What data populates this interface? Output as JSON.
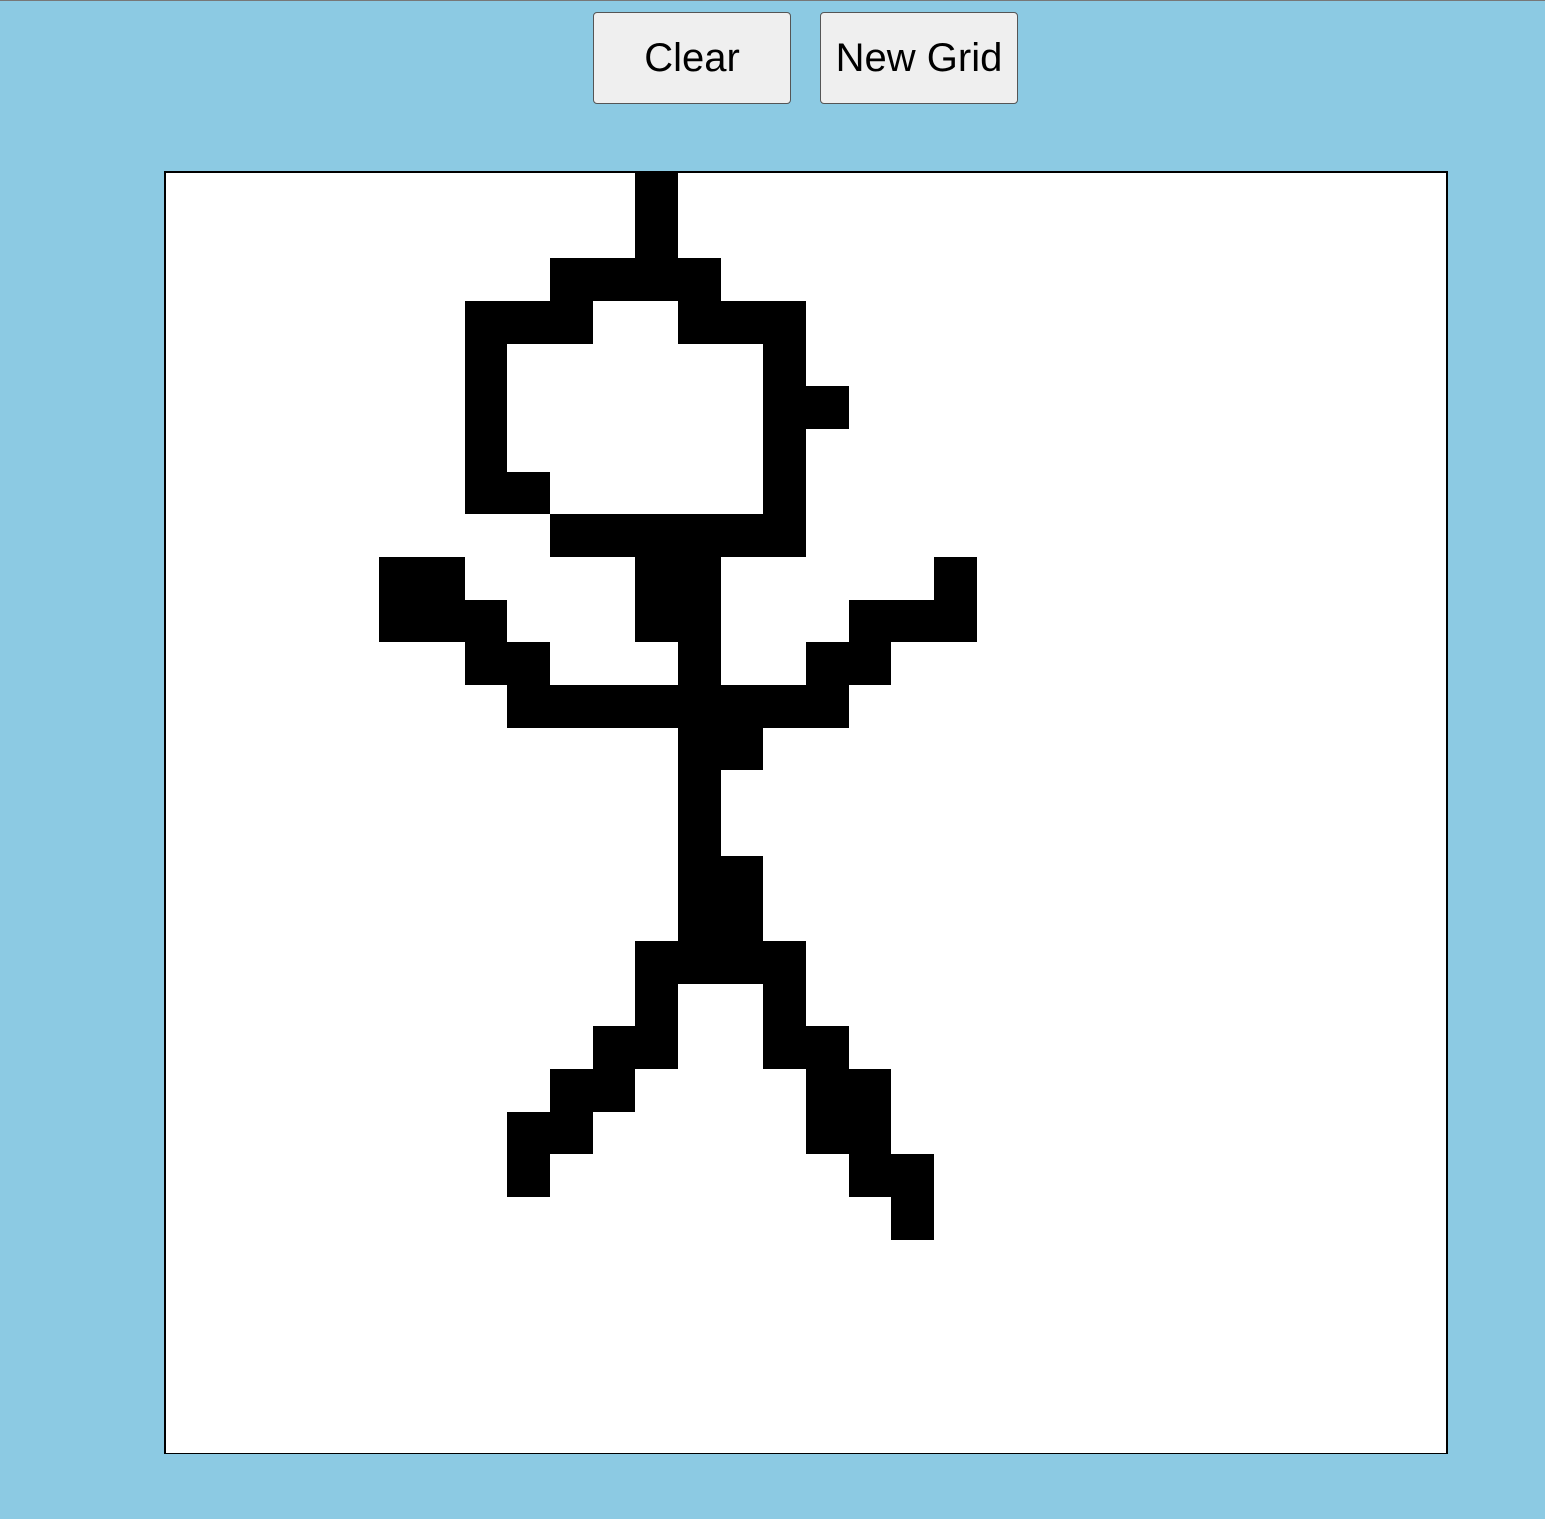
{
  "toolbar": {
    "clear_label": "Clear",
    "new_grid_label": "New Grid"
  },
  "grid": {
    "cols": 30,
    "rows": 30,
    "fill_color": "#000000",
    "empty_color": "#ffffff",
    "background_color": "#8ccae3",
    "filled_cells": [
      [
        0,
        11
      ],
      [
        1,
        11
      ],
      [
        2,
        9
      ],
      [
        2,
        10
      ],
      [
        2,
        11
      ],
      [
        2,
        12
      ],
      [
        3,
        7
      ],
      [
        3,
        8
      ],
      [
        3,
        9
      ],
      [
        3,
        12
      ],
      [
        3,
        13
      ],
      [
        3,
        14
      ],
      [
        4,
        7
      ],
      [
        4,
        14
      ],
      [
        5,
        7
      ],
      [
        5,
        14
      ],
      [
        5,
        15
      ],
      [
        6,
        7
      ],
      [
        6,
        14
      ],
      [
        7,
        7
      ],
      [
        7,
        8
      ],
      [
        7,
        14
      ],
      [
        8,
        9
      ],
      [
        8,
        10
      ],
      [
        8,
        11
      ],
      [
        8,
        12
      ],
      [
        8,
        13
      ],
      [
        8,
        14
      ],
      [
        9,
        5
      ],
      [
        9,
        6
      ],
      [
        9,
        11
      ],
      [
        9,
        12
      ],
      [
        9,
        18
      ],
      [
        10,
        5
      ],
      [
        10,
        6
      ],
      [
        10,
        7
      ],
      [
        10,
        11
      ],
      [
        10,
        12
      ],
      [
        10,
        16
      ],
      [
        10,
        17
      ],
      [
        10,
        18
      ],
      [
        11,
        7
      ],
      [
        11,
        8
      ],
      [
        11,
        12
      ],
      [
        11,
        15
      ],
      [
        11,
        16
      ],
      [
        12,
        8
      ],
      [
        12,
        9
      ],
      [
        12,
        10
      ],
      [
        12,
        11
      ],
      [
        12,
        12
      ],
      [
        12,
        13
      ],
      [
        12,
        14
      ],
      [
        12,
        15
      ],
      [
        13,
        12
      ],
      [
        13,
        13
      ],
      [
        14,
        12
      ],
      [
        15,
        12
      ],
      [
        16,
        12
      ],
      [
        16,
        13
      ],
      [
        17,
        12
      ],
      [
        17,
        13
      ],
      [
        18,
        11
      ],
      [
        18,
        12
      ],
      [
        18,
        13
      ],
      [
        18,
        14
      ],
      [
        19,
        11
      ],
      [
        19,
        14
      ],
      [
        20,
        10
      ],
      [
        20,
        11
      ],
      [
        20,
        14
      ],
      [
        20,
        15
      ],
      [
        21,
        9
      ],
      [
        21,
        10
      ],
      [
        21,
        15
      ],
      [
        21,
        16
      ],
      [
        22,
        8
      ],
      [
        22,
        9
      ],
      [
        22,
        15
      ],
      [
        22,
        16
      ],
      [
        23,
        8
      ],
      [
        23,
        16
      ],
      [
        23,
        17
      ],
      [
        24,
        17
      ]
    ]
  }
}
